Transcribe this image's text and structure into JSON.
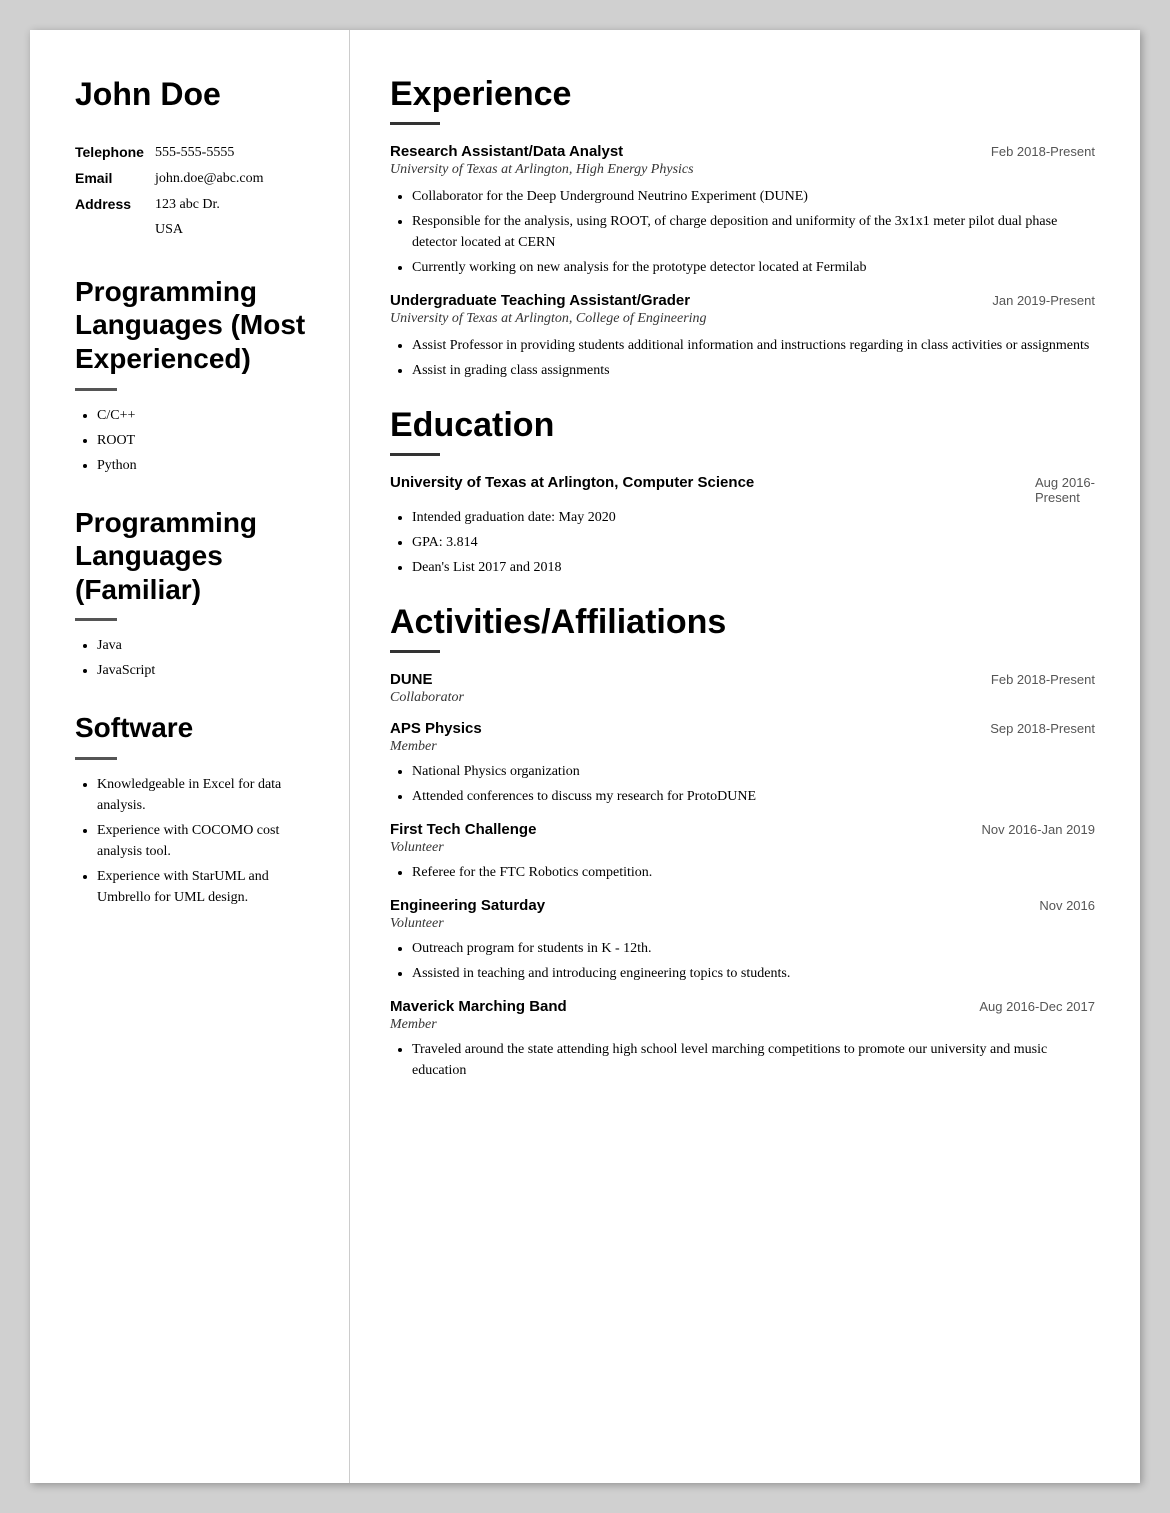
{
  "person": {
    "name": "John Doe",
    "telephone": "555-555-5555",
    "email": "john.doe@abc.com",
    "address_line1": "123 abc Dr.",
    "address_line2": "USA"
  },
  "left": {
    "tel_label": "Telephone",
    "email_label": "Email",
    "address_label": "Address",
    "prog_most_title": "Programming Languages (Most Experienced)",
    "prog_familiar_title": "Programming Languages (Familiar)",
    "software_title": "Software",
    "prog_most_items": [
      "C/C++",
      "ROOT",
      "Python"
    ],
    "prog_familiar_items": [
      "Java",
      "JavaScript"
    ],
    "software_items": [
      "Knowledgeable in Excel for data analysis.",
      "Experience with COCOMO cost analysis tool.",
      "Experience with StarUML and Umbrello for UML design."
    ]
  },
  "experience": {
    "section_title": "Experience",
    "jobs": [
      {
        "title": "Research Assistant/Data Analyst",
        "date": "Feb 2018-Present",
        "institution": "University of Texas at Arlington, High Energy Physics",
        "bullets": [
          "Collaborator for the Deep Underground Neutrino Experiment (DUNE)",
          "Responsible for the analysis, using ROOT, of charge deposition and uniformity of the 3x1x1 meter pilot dual phase detector located at CERN",
          "Currently working on new analysis for the prototype detector located at Fermilab"
        ]
      },
      {
        "title": "Undergraduate Teaching Assistant/Grader",
        "date": "Jan 2019-Present",
        "institution": "University of Texas at Arlington, College of Engineering",
        "bullets": [
          "Assist Professor in providing students additional information and instructions regarding in class activities or assignments",
          "Assist in grading class assignments"
        ]
      }
    ]
  },
  "education": {
    "section_title": "Education",
    "entries": [
      {
        "title": "University of Texas at Arlington, Computer Science",
        "date": "Aug 2016-Present",
        "bullets": [
          "Intended graduation date: May 2020",
          "GPA: 3.814",
          "Dean's List 2017 and 2018"
        ]
      }
    ]
  },
  "activities": {
    "section_title": "Activities/Affiliations",
    "items": [
      {
        "title": "DUNE",
        "date": "Feb 2018-Present",
        "role": "Collaborator",
        "bullets": []
      },
      {
        "title": "APS Physics",
        "date": "Sep 2018-Present",
        "role": "Member",
        "bullets": [
          "National Physics organization",
          "Attended conferences to discuss my research for ProtoDUNE"
        ]
      },
      {
        "title": "First Tech Challenge",
        "date": "Nov 2016-Jan 2019",
        "role": "Volunteer",
        "bullets": [
          "Referee for the FTC Robotics competition."
        ]
      },
      {
        "title": "Engineering Saturday",
        "date": "Nov 2016",
        "role": "Volunteer",
        "bullets": [
          "Outreach program for students in K - 12th.",
          "Assisted in teaching and introducing engineering topics to students."
        ]
      },
      {
        "title": "Maverick Marching Band",
        "date": "Aug 2016-Dec 2017",
        "role": "Member",
        "bullets": [
          "Traveled around the state attending high school level marching competitions to promote our university and music education"
        ]
      }
    ]
  }
}
